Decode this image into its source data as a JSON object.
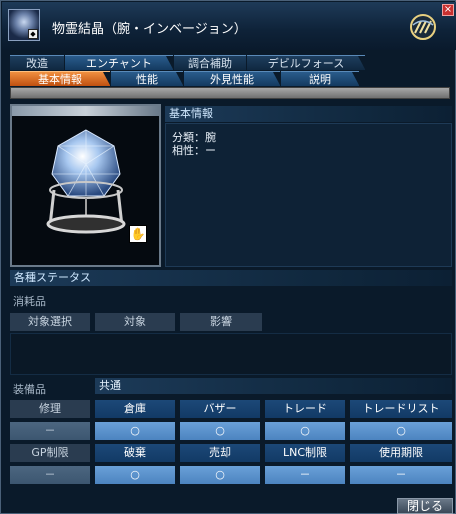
{
  "window": {
    "title": "物霊結晶（腕・インベージョン）",
    "close_glyph": "×"
  },
  "tabs_top": [
    {
      "label": "改造"
    },
    {
      "label": "エンチャント"
    },
    {
      "label": "調合補助"
    },
    {
      "label": "デビルフォース"
    }
  ],
  "tabs_sub": [
    {
      "label": "基本情報",
      "active": true
    },
    {
      "label": "性能"
    },
    {
      "label": "外見性能"
    },
    {
      "label": "説明"
    }
  ],
  "basic_info": {
    "heading": "基本情報",
    "lines": [
      "分類：腕",
      "相性：ー"
    ]
  },
  "status": {
    "heading": "各種ステータス",
    "consumable_label": "消耗品",
    "consumable_cols": [
      "対象選択",
      "対象",
      "影響"
    ],
    "equipment_label": "装備品",
    "common_label": "共通",
    "row1_header": "修理",
    "row1_cols": [
      "倉庫",
      "バザー",
      "トレード",
      "トレードリスト"
    ],
    "row1_values": [
      "－",
      "○",
      "○",
      "○",
      "○"
    ],
    "row2_header": "GP制限",
    "row2_cols": [
      "破棄",
      "売却",
      "LNC制限",
      "使用期限"
    ],
    "row2_values": [
      "－",
      "○",
      "○",
      "－",
      "－"
    ]
  },
  "footer": {
    "close_label": "閉じる"
  },
  "icons": {
    "hand": "✋",
    "mini": "◆"
  },
  "colors": {
    "active_tab": "#e07020",
    "tab_blue": "#1e4a78",
    "value_cell": "#5a94d0"
  }
}
